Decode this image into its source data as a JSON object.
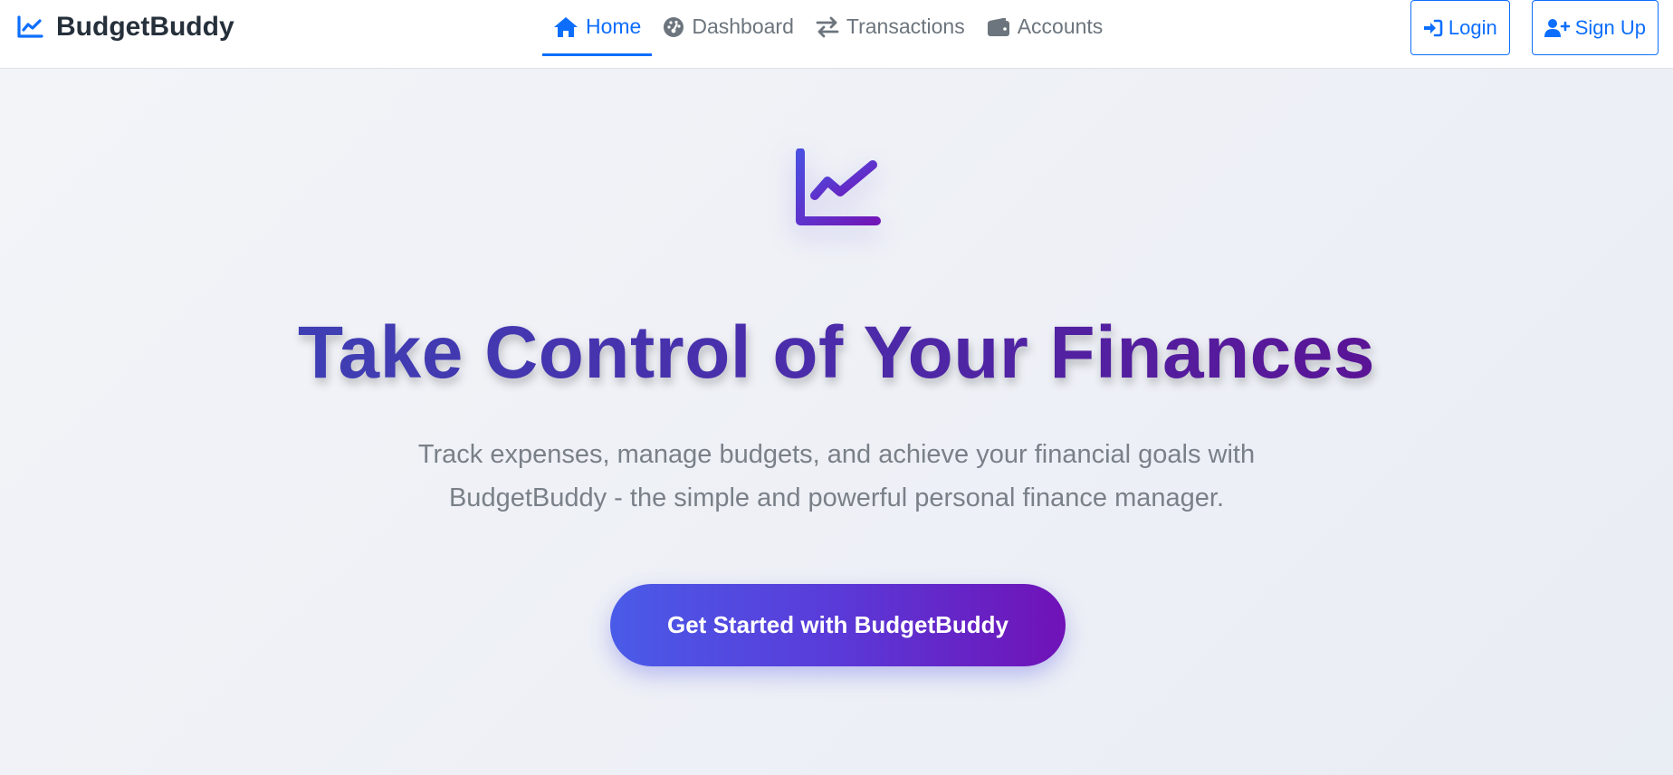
{
  "brand": {
    "name": "BudgetBuddy",
    "icon": "chart-line-icon"
  },
  "nav": {
    "items": [
      {
        "label": "Home",
        "icon": "home-icon",
        "active": true
      },
      {
        "label": "Dashboard",
        "icon": "gauge-icon",
        "active": false
      },
      {
        "label": "Transactions",
        "icon": "exchange-arrows-icon",
        "active": false
      },
      {
        "label": "Accounts",
        "icon": "wallet-icon",
        "active": false
      }
    ]
  },
  "auth": {
    "login_label": "Login",
    "signup_label": "Sign Up"
  },
  "hero": {
    "icon": "chart-line-icon",
    "title": "Take Control of Your Finances",
    "subtitle_line1": "Track expenses, manage budgets, and achieve your financial goals with",
    "subtitle_line2": "BudgetBuddy - the simple and powerful personal finance manager.",
    "cta_label": "Get Started with BudgetBuddy"
  },
  "colors": {
    "primary": "#0d6efd",
    "text_dark": "#25303b",
    "muted": "#6c757d",
    "gradient_start": "#4a5be8",
    "gradient_end": "#7012b7"
  }
}
